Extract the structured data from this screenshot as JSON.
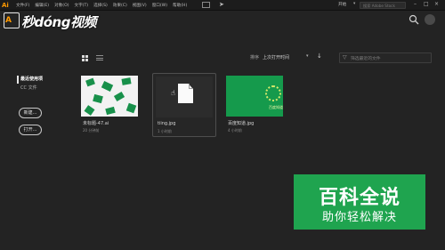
{
  "app": {
    "logo": "Ai"
  },
  "menu": {
    "items": [
      "文件(F)",
      "编辑(E)",
      "对象(O)",
      "文字(T)",
      "选择(S)",
      "效果(C)",
      "视图(V)",
      "窗口(W)",
      "帮助(H)"
    ],
    "workspace": "开始",
    "search_placeholder": "搜索 Adobe Stock"
  },
  "watermark_top": {
    "box": "A",
    "text": "秒dóng视频"
  },
  "toolbar": {
    "sort_label": "排序",
    "sort_value": "上次打开时间",
    "filter_placeholder": "筛选最近的文件"
  },
  "sidebar": {
    "recent": "最近使用项",
    "cc_files": "CC 文件",
    "new_button": "新建...",
    "open_button": "打开..."
  },
  "files": [
    {
      "name": "未标题-47.ai",
      "time": "20 分钟前",
      "thumb": "white-green-rects"
    },
    {
      "name": "tiing.jpg",
      "time": "1 小时前",
      "thumb": "document-icon"
    },
    {
      "name": "百度知道.jpg",
      "time": "4 小时前",
      "thumb": "green-image"
    }
  ],
  "thumb_caption": "百度知道",
  "watermark_bottom": {
    "main": "百科全说",
    "sub": "助你轻松解决"
  },
  "colors": {
    "background": "#232323",
    "accent_orange": "#ff9a00",
    "green": "#17904a",
    "watermark_green": "#1fa44f"
  }
}
